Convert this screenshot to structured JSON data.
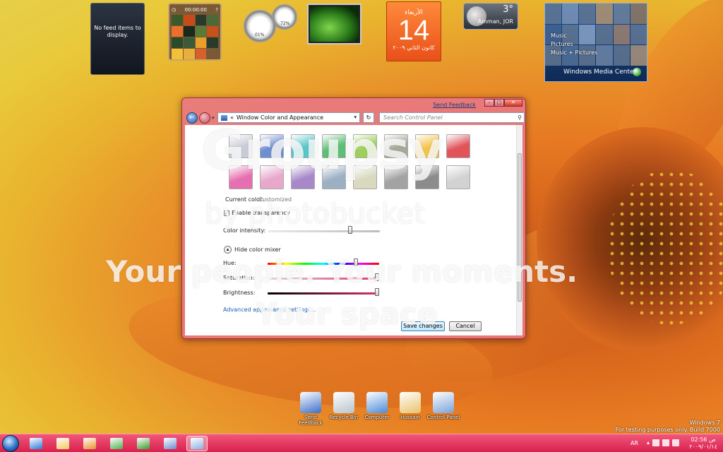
{
  "gadgets": {
    "feed": {
      "text": "No feed items to display."
    },
    "puzzle": {
      "timer": "00:00:00"
    },
    "meter": {
      "cpu": "01%",
      "ram": "72%"
    },
    "calendar": {
      "weekday": "الأربعاء",
      "date": "14",
      "month": "كانون الثاني ٢٠٠٩"
    },
    "weather": {
      "temp": "3°",
      "city": "Amman, JOR"
    },
    "media_center": {
      "items": [
        "Music",
        "Pictures",
        "Music + Pictures"
      ],
      "brand": "Windows Media Center"
    }
  },
  "window": {
    "send_feedback": "Send Feedback",
    "address": "Window Color and Appearance",
    "address_prefix": "«",
    "search_placeholder": "Search Control Panel",
    "current_color_label": "Current color:",
    "current_color_value": "Customized",
    "transparency_label": "Enable transparency",
    "intensity_label": "Color intensity:",
    "mixer_toggle_label": "Hide color mixer",
    "hue_label": "Hue:",
    "saturation_label": "Saturation:",
    "brightness_label": "Brightness:",
    "advanced_link": "Advanced appearance settings...",
    "save_label": "Save changes",
    "cancel_label": "Cancel",
    "swatch_colors": [
      "#c9ccd6",
      "#6f8fd0",
      "#5ac6c9",
      "#5cbf73",
      "#9dd05a",
      "#a6a89a",
      "#f2c44c",
      "#e0545a",
      "#e66fb0",
      "#e7a8cc",
      "#a788c9",
      "#9cb0c4",
      "#d9d9c0",
      "#a3a3a3",
      "#8c8c8c",
      "#d2d2d2"
    ],
    "intensity": 0.75,
    "hue": 0.8,
    "saturation": 1.0,
    "brightness": 1.0
  },
  "watermark": {
    "logo": "Groupsy",
    "by": "by photobucket",
    "line1": "Your people. Your moments.",
    "line2": "Your space"
  },
  "desktop_icons": [
    {
      "label": "Send Feedback",
      "color": "#3a6ec8"
    },
    {
      "label": "Recycle Bin",
      "color": "#b8c4cc"
    },
    {
      "label": "Computer",
      "color": "#4a8ad8"
    },
    {
      "label": "Hussain",
      "color": "#e8c26a"
    },
    {
      "label": "Control Panel",
      "color": "#7aa2d8"
    }
  ],
  "windows_info": {
    "line1": "Windows 7",
    "line2": "For testing purposes only. Build 7000"
  },
  "taskbar": {
    "apps": [
      {
        "icon": "internet-explorer-icon",
        "color": "#2a7ad8"
      },
      {
        "icon": "folder-icon",
        "color": "#f2c65a"
      },
      {
        "icon": "media-player-icon",
        "color": "#e8902a"
      },
      {
        "icon": "windows-flag-icon",
        "color": "#4cb04c"
      },
      {
        "icon": "utorrent-icon",
        "color": "#3a9a2a"
      },
      {
        "icon": "network-icon",
        "color": "#6a8ad0"
      },
      {
        "icon": "control-panel-icon",
        "color": "#8ab0e0"
      }
    ],
    "lang": "AR",
    "time": "02:56 ص",
    "date": "٢٠٠٩/٠١/١٤"
  }
}
